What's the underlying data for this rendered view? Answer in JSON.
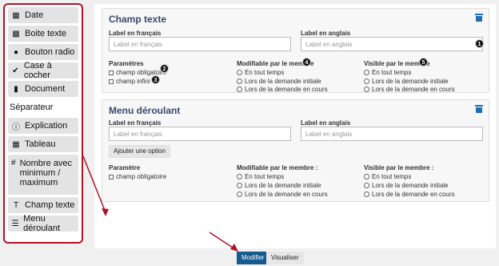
{
  "sidebar": {
    "items": [
      {
        "label": "Date",
        "icon": "calendar-icon"
      },
      {
        "label": "Boite texte",
        "icon": "textbox-icon"
      },
      {
        "label": "Bouton radio",
        "icon": "radio-icon"
      },
      {
        "label": "Case à cocher",
        "icon": "check-circle-icon"
      },
      {
        "label": "Document",
        "icon": "document-icon"
      },
      {
        "label": "Séparateur",
        "icon": ""
      },
      {
        "label": "Explication",
        "icon": "info-icon"
      },
      {
        "label": "Tableau",
        "icon": "table-icon"
      },
      {
        "label": "Nombre avec minimum / maximum",
        "icon": "hash-icon"
      },
      {
        "label": "Champ texte",
        "icon": "text-field-icon"
      },
      {
        "label": "Menu déroulant",
        "icon": "list-icon"
      }
    ]
  },
  "card1": {
    "title": "Champ texte",
    "label_fr": "Label en français",
    "label_en": "Label en anglais",
    "placeholder_fr": "Label en français",
    "placeholder_en": "Label en anglais",
    "params_label": "Paramètres",
    "param_options": [
      "champ obligatoire",
      "champ infini"
    ],
    "modif_label": "Modifiable par le membre",
    "visible_label": "Visible par le membre",
    "modif_options": [
      "En tout temps",
      "Lors de la demande initiale",
      "Lors de la demande en cours"
    ],
    "visible_options": [
      "En tout temps",
      "Lors de la demande initiale",
      "Lors de la demande en cours"
    ],
    "badges": [
      "1",
      "2",
      "3",
      "4",
      "5"
    ]
  },
  "card2": {
    "title": "Menu déroulant",
    "label_fr": "Label en français",
    "label_en": "Label en anglais",
    "placeholder_fr": "Label en français",
    "placeholder_en": "Label en anglais",
    "add_option": "Ajouter une option",
    "params_label": "Paramètre",
    "param_options": [
      "champ obligatoire"
    ],
    "modif_label": "Modifiable par le membre :",
    "visible_label": "Visible par le membre :",
    "modif_options": [
      "En tout temps",
      "Lors de la demande initiale",
      "Lors de la demande en cours"
    ],
    "visible_options": [
      "En tout temps",
      "Lors de la demande initiale",
      "Lors de la demande en cours"
    ]
  },
  "footer": {
    "modifier": "Modifier",
    "visualiser": "Visualiser"
  },
  "colors": {
    "accent": "#175a8f",
    "highlight": "#b11226",
    "title": "#3a4a6b"
  }
}
